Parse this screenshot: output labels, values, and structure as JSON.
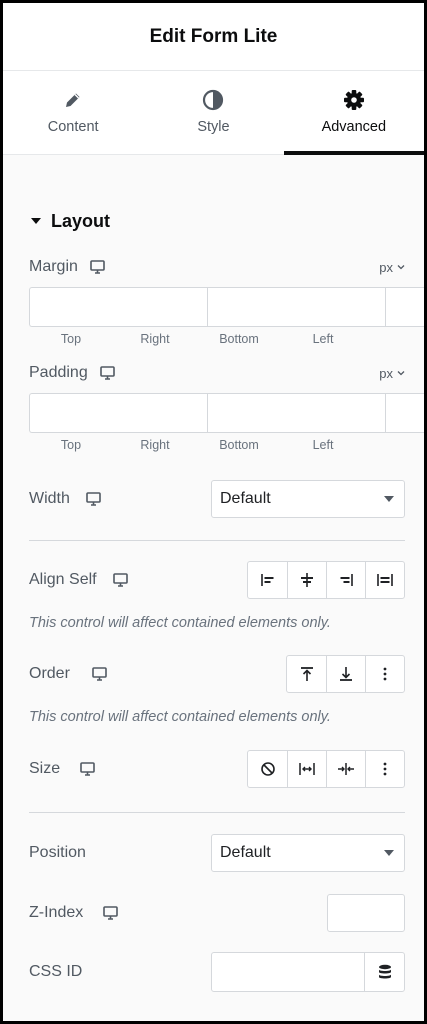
{
  "header": {
    "title": "Edit Form Lite"
  },
  "tabs": [
    {
      "label": "Content",
      "icon": "pencil-icon",
      "active": false
    },
    {
      "label": "Style",
      "icon": "contrast-icon",
      "active": false
    },
    {
      "label": "Advanced",
      "icon": "gear-icon",
      "active": true
    }
  ],
  "section": {
    "title": "Layout",
    "icon": "caret-down-icon"
  },
  "margin": {
    "label": "Margin",
    "unit": "px",
    "values": {
      "top": "",
      "right": "",
      "bottom": "",
      "left": ""
    },
    "sides": [
      "Top",
      "Right",
      "Bottom",
      "Left"
    ]
  },
  "padding": {
    "label": "Padding",
    "unit": "px",
    "values": {
      "top": "",
      "right": "",
      "bottom": "",
      "left": ""
    },
    "sides": [
      "Top",
      "Right",
      "Bottom",
      "Left"
    ]
  },
  "width": {
    "label": "Width",
    "value": "Default"
  },
  "align_self": {
    "label": "Align Self",
    "options": [
      "align-start-icon",
      "align-center-icon",
      "align-end-icon",
      "align-stretch-icon"
    ],
    "note": "This control will affect contained elements only."
  },
  "order": {
    "label": "Order",
    "options": [
      "order-first-icon",
      "order-last-icon",
      "more-icon"
    ],
    "note": "This control will affect contained elements only."
  },
  "size": {
    "label": "Size",
    "options": [
      "none-icon",
      "grow-icon",
      "shrink-icon",
      "more-icon"
    ]
  },
  "position": {
    "label": "Position",
    "value": "Default"
  },
  "z_index": {
    "label": "Z-Index",
    "value": ""
  },
  "css_id": {
    "label": "CSS ID",
    "value": "",
    "icon": "database-icon"
  },
  "colors": {
    "accent": "#0c0d0e",
    "border": "#d5d8dc",
    "muted": "#69727d"
  }
}
